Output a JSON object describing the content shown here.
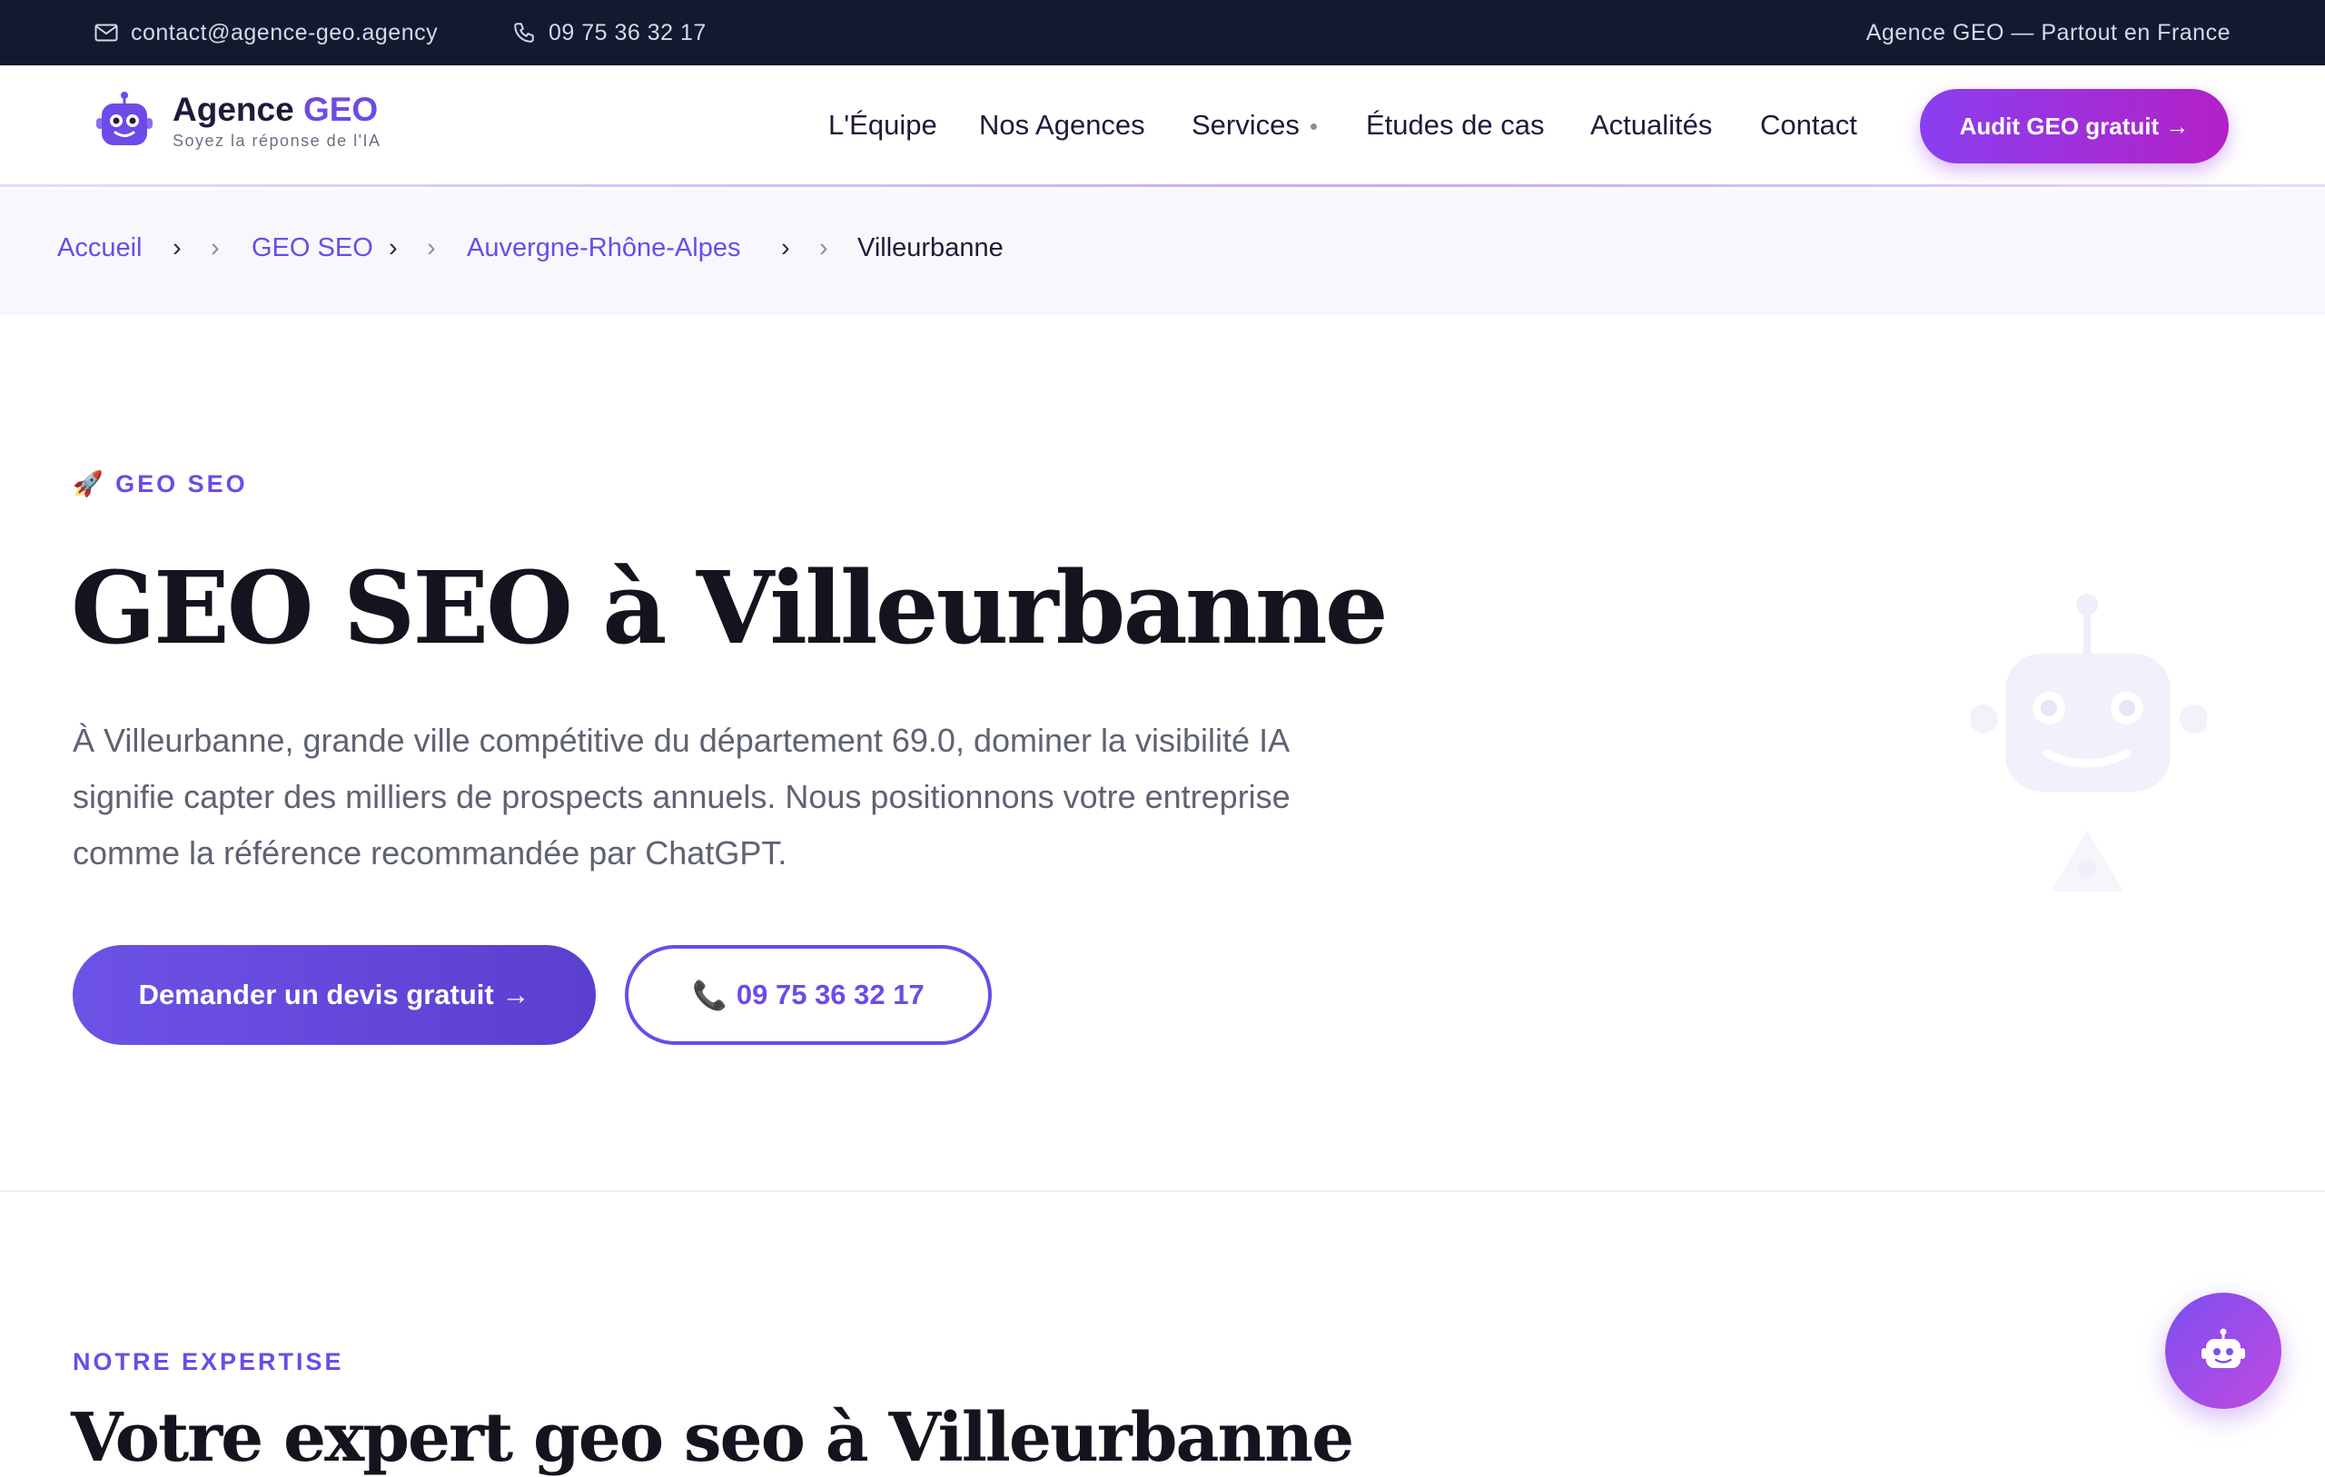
{
  "topbar": {
    "email": "contact@agence-geo.agency",
    "phone": "09 75 36 32 17",
    "tagline": "Agence GEO — Partout en France"
  },
  "brand": {
    "name_part1": "Agence ",
    "name_part2": "GEO",
    "subtitle": "Soyez la réponse de l'IA",
    "accent": "#6c4be8"
  },
  "nav": {
    "items": [
      {
        "label": "L'Équipe"
      },
      {
        "label": "Nos Agences"
      },
      {
        "label": "Services"
      },
      {
        "label": "Études de cas"
      },
      {
        "label": "Actualités"
      },
      {
        "label": "Contact"
      }
    ],
    "cta": "Audit GEO gratuit →"
  },
  "breadcrumb": {
    "items": [
      "Accueil",
      "GEO SEO",
      "Auvergne-Rhône-Alpes"
    ],
    "current": "Villeurbanne",
    "sep": "›"
  },
  "hero": {
    "eyebrow": "🚀 GEO SEO",
    "title": "GEO SEO à Villeurbanne",
    "lead": "À Villeurbanne, grande ville compétitive du département 69.0, dominer la visibilité IA signifie capter des milliers de prospects annuels. Nous positionnons votre entreprise comme la référence recommandée par ChatGPT.",
    "primary_button": "Demander un devis gratuit →",
    "phone_icon": "📞",
    "phone_button": "09 75 36 32 17"
  },
  "expertise": {
    "eyebrow": "NOTRE EXPERTISE",
    "title": "Votre expert geo seo à Villeurbanne"
  },
  "icons": {
    "email": "mail-icon",
    "phone": "phone-icon",
    "logo": "robot-logo-icon",
    "hero_art": "robot-illustration-icon",
    "chat": "chatbot-icon"
  }
}
